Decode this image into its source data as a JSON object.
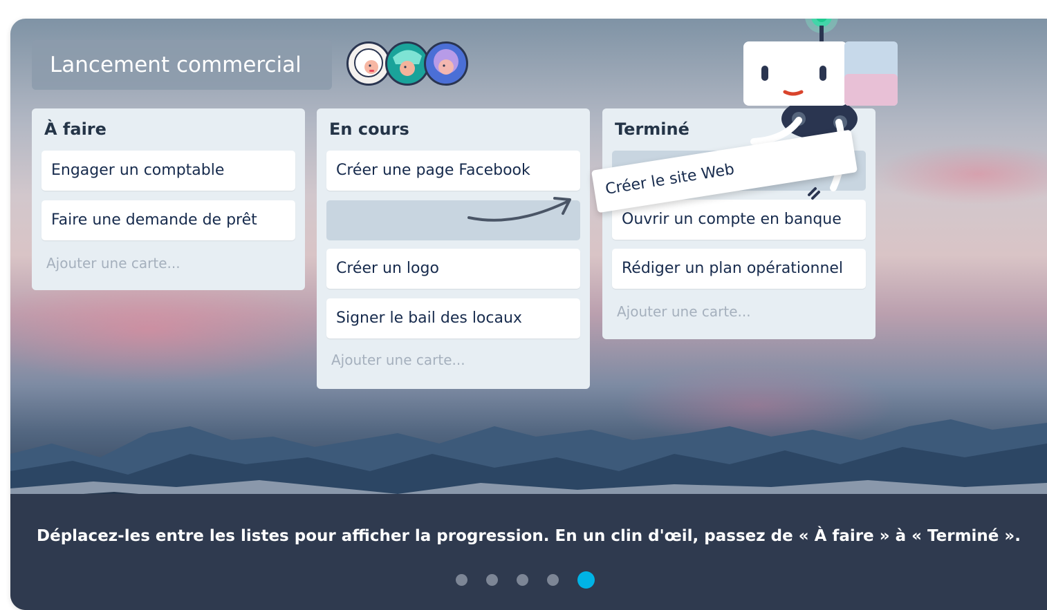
{
  "board": {
    "title": "Lancement commercial",
    "members": [
      "avatar-1",
      "avatar-2",
      "avatar-3"
    ]
  },
  "lists": [
    {
      "title": "À faire",
      "cards": [
        "Engager un comptable",
        "Faire une demande de prêt"
      ],
      "add_label": "Ajouter une carte..."
    },
    {
      "title": "En cours",
      "cards": [
        "Créer une page Facebook",
        "Créer un logo",
        "Signer le bail des locaux"
      ],
      "add_label": "Ajouter une carte..."
    },
    {
      "title": "Terminé",
      "cards": [
        "Ouvrir un compte en banque",
        "Rédiger un plan opérationnel"
      ],
      "add_label": "Ajouter une carte..."
    }
  ],
  "dragging_card": "Créer le site Web",
  "caption": "Déplacez-les entre les listes pour afficher la progression. En un clin d'œil, passez de « À faire » à « Terminé ».",
  "carousel": {
    "count": 5,
    "active": 5
  },
  "colors": {
    "accent": "#00b3e6",
    "caption_bg": "#2f3a4f",
    "list_bg": "#e7eef3"
  }
}
